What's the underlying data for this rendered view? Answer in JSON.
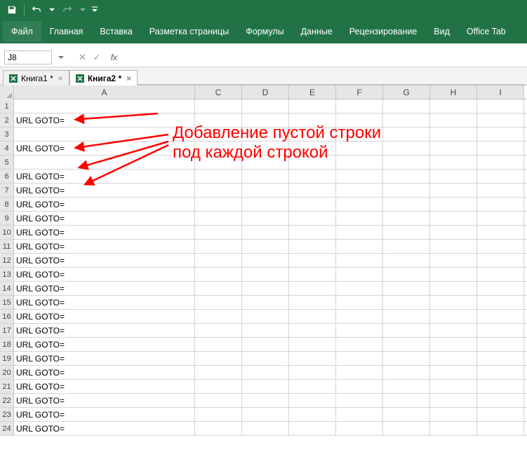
{
  "titlebar": {
    "save": "save",
    "undo": "undo",
    "redo": "redo"
  },
  "ribbon": {
    "file": "Файл",
    "home": "Главная",
    "insert": "Вставка",
    "layout": "Разметка страницы",
    "formulas": "Формулы",
    "data": "Данные",
    "review": "Рецензирование",
    "view": "Вид",
    "office_tab": "Office Tab"
  },
  "namebox": {
    "ref": "J8",
    "fx": "fx"
  },
  "workbook_tabs": [
    {
      "label": "Книга1 *",
      "active": false
    },
    {
      "label": "Книга2 *",
      "active": true
    }
  ],
  "columns": [
    "A",
    "C",
    "D",
    "E",
    "F",
    "G",
    "H",
    "I"
  ],
  "rows": [
    {
      "n": 1,
      "A": ""
    },
    {
      "n": 2,
      "A": "URL GOTO="
    },
    {
      "n": 3,
      "A": ""
    },
    {
      "n": 4,
      "A": "URL GOTO="
    },
    {
      "n": 5,
      "A": ""
    },
    {
      "n": 6,
      "A": "URL GOTO="
    },
    {
      "n": 7,
      "A": "URL GOTO="
    },
    {
      "n": 8,
      "A": "URL GOTO="
    },
    {
      "n": 9,
      "A": "URL GOTO="
    },
    {
      "n": 10,
      "A": "URL GOTO="
    },
    {
      "n": 11,
      "A": "URL GOTO="
    },
    {
      "n": 12,
      "A": "URL GOTO="
    },
    {
      "n": 13,
      "A": "URL GOTO="
    },
    {
      "n": 14,
      "A": "URL GOTO="
    },
    {
      "n": 15,
      "A": "URL GOTO="
    },
    {
      "n": 16,
      "A": "URL GOTO="
    },
    {
      "n": 17,
      "A": "URL GOTO="
    },
    {
      "n": 18,
      "A": "URL GOTO="
    },
    {
      "n": 19,
      "A": "URL GOTO="
    },
    {
      "n": 20,
      "A": "URL GOTO="
    },
    {
      "n": 21,
      "A": "URL GOTO="
    },
    {
      "n": 22,
      "A": "URL GOTO="
    },
    {
      "n": 23,
      "A": "URL GOTO="
    },
    {
      "n": 24,
      "A": "URL GOTO="
    }
  ],
  "annotation": {
    "line1": "Добавление пустой строки",
    "line2": "под каждой строкой"
  }
}
